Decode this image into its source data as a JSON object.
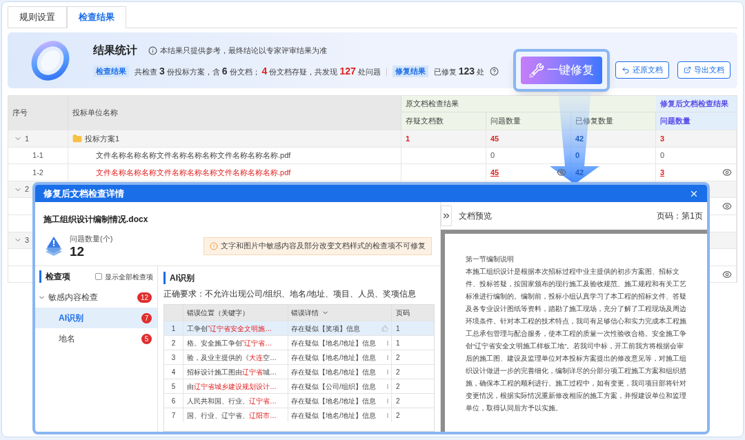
{
  "tabs": [
    {
      "label": "规则设置",
      "selected": false
    },
    {
      "label": "检查结果",
      "selected": true
    }
  ],
  "banner": {
    "title": "结果统计",
    "notice": "本结果只提供参考，最终结论以专家评审结果为准",
    "check_label": "检查结果",
    "check_summary": [
      {
        "text": "共检查",
        "kind": "plain"
      },
      {
        "text": "3",
        "kind": "num"
      },
      {
        "text": "份投标方案，含",
        "kind": "plain"
      },
      {
        "text": "6",
        "kind": "num"
      },
      {
        "text": "份文档；",
        "kind": "plain"
      },
      {
        "text": "4",
        "kind": "alert"
      },
      {
        "text": "份文档存疑，共发现",
        "kind": "plain"
      },
      {
        "text": "127",
        "kind": "alert"
      },
      {
        "text": "处问题",
        "kind": "plain"
      }
    ],
    "repair_label": "修复结果",
    "repair_summary": [
      {
        "text": "已修复",
        "kind": "plain"
      },
      {
        "text": "123",
        "kind": "num"
      },
      {
        "text": "处",
        "kind": "plain"
      }
    ],
    "repair_button": "一键修复",
    "restore_button": "还原文档",
    "export_button": "导出文档"
  },
  "table": {
    "columns": [
      "序号",
      "投标单位名称"
    ],
    "original_group": "原文档检查结果",
    "original_columns": [
      "存疑文档数",
      "问题数量",
      "已修复数量"
    ],
    "repaired_group": "修复后文档检查结果",
    "repaired_columns": [
      "问题数量"
    ],
    "rows": [
      {
        "kind": "group",
        "seq": "1",
        "expanded": true,
        "name": "投标方案1",
        "cells": {
          "suspect": {
            "text": "1",
            "kind": "alert"
          },
          "issues": {
            "text": "45",
            "kind": "alert"
          },
          "fixed": {
            "text": "42",
            "kind": "fixed"
          },
          "after": {
            "text": "3",
            "kind": "alert"
          }
        }
      },
      {
        "kind": "file",
        "seq": "1-1",
        "alert": false,
        "name": "文件名称名称名称文件名称名称名称文件名称名称名称.pdf",
        "cells": {
          "issues": {
            "text": "0",
            "kind": "plain"
          },
          "fixed": {
            "text": "0",
            "kind": "fixed"
          },
          "after": {
            "text": "0",
            "kind": "plain"
          }
        }
      },
      {
        "kind": "file",
        "seq": "1-2",
        "alert": true,
        "name": "文件名称名称名称文件名称名称名称文件名称名称名称.pdf",
        "cells": {
          "issues": {
            "text": "45",
            "kind": "link",
            "eye": true
          },
          "fixed": {
            "text": "42",
            "kind": "fixed"
          },
          "after": {
            "text": "3",
            "kind": "link",
            "eye": true
          }
        }
      },
      {
        "kind": "group",
        "seq": "2",
        "expanded": true
      },
      {
        "kind": "hidden",
        "eye": true
      },
      {
        "kind": "hidden"
      },
      {
        "kind": "group",
        "seq": "3",
        "expanded": true
      },
      {
        "kind": "hidden"
      },
      {
        "kind": "hidden",
        "eye": true
      }
    ]
  },
  "modal": {
    "title": "修复后文档检查详情",
    "file_name": "施工组织设计编制情况.docx",
    "count_label": "问题数量(个)",
    "count": "12",
    "notice": "文字和图片中敏感内容及部分改变文档样式的检查项不可修复",
    "sidebar": {
      "heading": "检查项",
      "show_all": {
        "label": "显示全部检查项",
        "checked": false
      },
      "items": [
        {
          "label": "敏感内容检查",
          "count": "12",
          "expanded": true,
          "children": [
            {
              "label": "AI识别",
              "count": "7",
              "selected": true
            },
            {
              "label": "地名",
              "count": "5",
              "selected": false
            }
          ]
        }
      ]
    },
    "section_title": "AI识别",
    "requirement": "正确要求：不允许出现公司/组织、地名/地址、项目、人员、奖项信息",
    "columns": [
      "错误位置（关键字）",
      "错误详情",
      "页码"
    ],
    "rows": [
      {
        "index": "1",
        "location": [
          {
            "text": "工争创",
            "hit": false
          },
          {
            "text": "“辽宁省安全文明施…",
            "hit": true
          }
        ],
        "detail": "存在疑似【奖项】信息",
        "page": "1",
        "selected": true
      },
      {
        "index": "2",
        "location": [
          {
            "text": "格。安全施工争创",
            "hit": false
          },
          {
            "text": "“辽宁省…",
            "hit": true
          }
        ],
        "detail": "存在疑似【地名/地址】信息",
        "page": "1",
        "selected": false
      },
      {
        "index": "3",
        "location": [
          {
            "text": "验，及业主提供的《",
            "hit": false
          },
          {
            "text": "大连",
            "hit": true
          },
          {
            "text": "空…",
            "hit": false
          }
        ],
        "detail": "存在疑似【地名/地址】信息",
        "page": "2",
        "selected": false
      },
      {
        "index": "4",
        "location": [
          {
            "text": "招标设计施工图由",
            "hit": false
          },
          {
            "text": "辽宁省",
            "hit": true
          },
          {
            "text": "城…",
            "hit": false
          }
        ],
        "detail": "存在疑似【地名/地址】信息",
        "page": "2",
        "selected": false
      },
      {
        "index": "5",
        "location": [
          {
            "text": "由",
            "hit": false
          },
          {
            "text": "辽宁省城乡建设规划设计…",
            "hit": true
          }
        ],
        "detail": "存在疑似【公司/组织】信息",
        "page": "2",
        "selected": false
      },
      {
        "index": "6",
        "location": [
          {
            "text": "人民共和国、行业、",
            "hit": false
          },
          {
            "text": "辽宁省…",
            "hit": true
          }
        ],
        "detail": "存在疑似【地名/地址】信息",
        "page": "2",
        "selected": false
      },
      {
        "index": "7",
        "location": [
          {
            "text": "国、行业、辽宁省、",
            "hit": false
          },
          {
            "text": "辽阳市…",
            "hit": true
          }
        ],
        "detail": "存在疑似【地名/地址】信息",
        "page": "2",
        "selected": false
      }
    ],
    "preview": {
      "title": "文档预览",
      "page": "页码：第1页",
      "doc_heading": "第一节编制说明",
      "doc_text": "本施工组织设计是根据本次招标过程中业主提供的初步方案图、招标文件、投标答疑，按国家颁布的现行施工及验收规范、施工规程和有关工艺标准进行编制的。编制前，投标小组认真学习了本工程的招标文件、答疑及各专业设计图纸等资料，踏勘了施工现场，充分了解了工程现场及周边环境条件。针对本工程的技术特点，我司有足够信心和实力完成本工程施工总承包管理与配合服务，使本工程的质量一次性验收合格。安全施工争创“辽宁省安全文明施工样板工地”。若我司中标，开工前我方将根据会审后的施工图、建设及监理单位对本投标方案提出的修改意见等，对施工组织设计做进一步的完善细化，编制详尽的分部分项工程施工方案和组织措施，确保本工程的顺利进行。施工过程中，如有变更，我司项目部将针对变更情况，根据实际情况重新修改相应的施工方案，并报建设单位和监理单位，取得认同后方予以实施。"
    }
  }
}
